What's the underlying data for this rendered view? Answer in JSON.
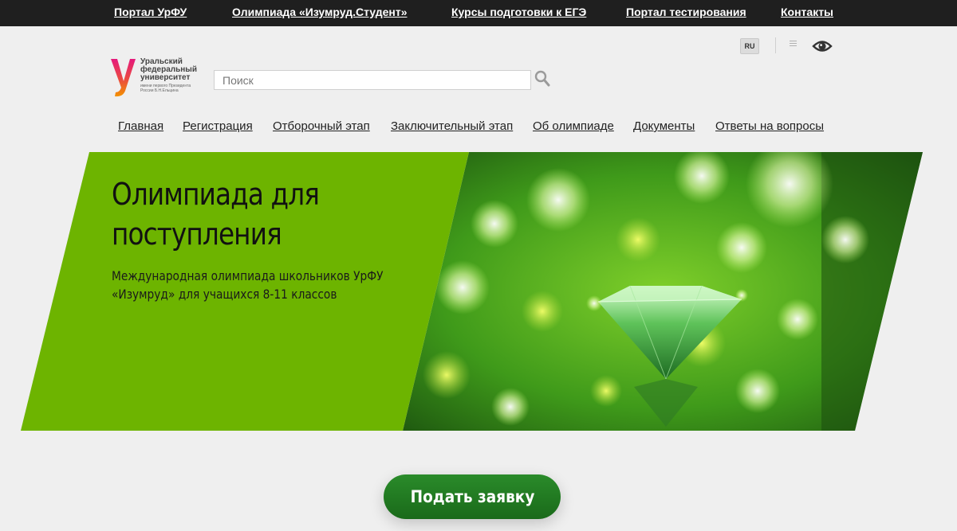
{
  "topbar": {
    "links": [
      {
        "label": "Портал УрФУ"
      },
      {
        "label": "Олимпиада «Изумруд.Студент»"
      },
      {
        "label": "Курсы подготовки к ЕГЭ"
      },
      {
        "label": "Портал тестирования"
      },
      {
        "label": "Контакты"
      }
    ]
  },
  "header": {
    "lang": "RU",
    "logo": {
      "title": "Уральский федеральный университет",
      "subtitle": "имени первого Президента России Б.Н.Ельцина"
    },
    "search": {
      "placeholder": "Поиск",
      "value": ""
    },
    "icons": [
      "list-icon",
      "eye-icon",
      "search-icon"
    ]
  },
  "nav": {
    "items": [
      {
        "label": "Главная"
      },
      {
        "label": "Регистрация"
      },
      {
        "label": "Отборочный этап"
      },
      {
        "label": "Заключительный этап"
      },
      {
        "label": "Об олимпиаде"
      },
      {
        "label": "Документы"
      },
      {
        "label": "Ответы на вопросы"
      }
    ]
  },
  "hero": {
    "title": "Олимпиада для поступления",
    "subtitle": "Международная олимпиада школьников УрФУ «Изумруд» для учащихся 8-11 классов"
  },
  "cta": {
    "label": "Подать заявку"
  },
  "colors": {
    "topbar": "#1f1f1f",
    "hero_green": "#6db400",
    "cta_green": "#1f761f",
    "logo_magenta": "#e5197c",
    "logo_orange": "#f39200"
  }
}
